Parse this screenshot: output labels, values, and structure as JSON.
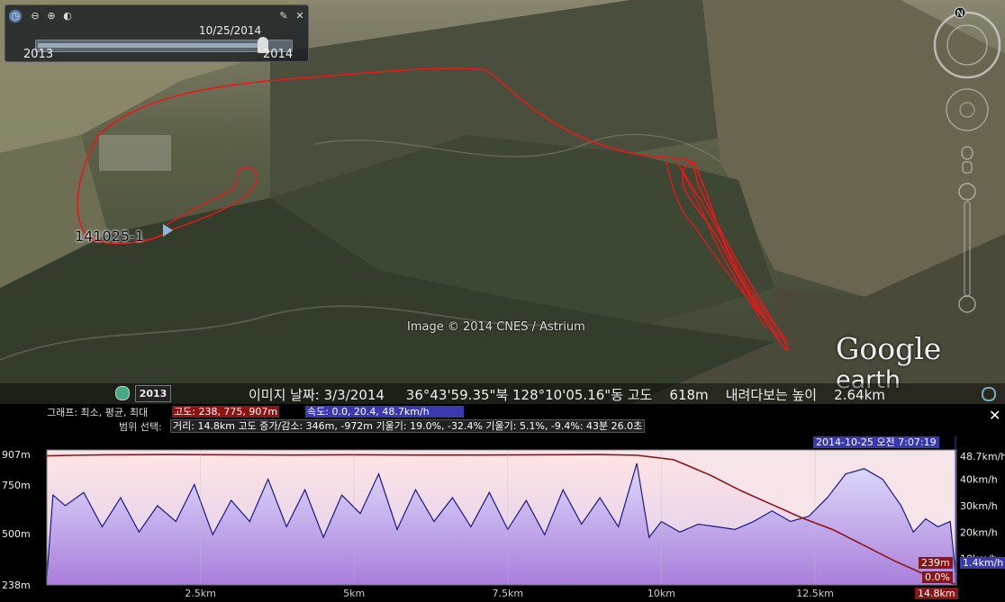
{
  "time_slider": {
    "current_date": "10/25/2014",
    "range_start": "2013",
    "range_end": "2014",
    "position_fraction": 0.9
  },
  "map": {
    "attribution": "Image © 2014 CNES / Astrium",
    "placemark_label": "141025-1",
    "logo_google": "Google",
    "logo_earth": "earth",
    "compass_letter": "N",
    "track_color": "#e8181a"
  },
  "status_bar": {
    "year_button": "2013",
    "text": "이미지 날짜: 3/3/2014     36°43'59.35\"북 128°10'05.16\"동 고도    618m    내려다보는 높이    2.64km"
  },
  "profile": {
    "graph_line_prefix": "그래프: 최소, 평균, 최대",
    "alt_stats": "고도: 238, 775, 907m",
    "speed_stats": "속도: 0.0, 20.4, 48.7km/h",
    "range_prefix": "범위 선택:",
    "range_stats": "거리: 14.8km 고도 증가/감소: 346m, -972m 기울기: 19.0%, -32.4% 기울기: 5.1%, -9.4%: 43분 26.0초",
    "hover_time": "2014-10-25 오전 7:07:19",
    "hover_alt": "239m",
    "hover_slope": "0.0%",
    "hover_dist": "14.8km",
    "hover_speed": "1.4km/h",
    "colors": {
      "altitude": "#8b1414",
      "speed": "#1a1a80",
      "alt_pill": "#8b1414",
      "speed_pill": "#3a3ab0"
    }
  },
  "chart_data": {
    "type": "area",
    "x_unit": "km",
    "xlim": [
      0,
      14.8
    ],
    "x_ticks": [
      "2.5km",
      "5km",
      "7.5km",
      "10km",
      "12.5km"
    ],
    "x_tick_values": [
      2.5,
      5,
      7.5,
      10,
      12.5
    ],
    "y_left_ticks": [
      "907m",
      "750m",
      "500m",
      "238m"
    ],
    "y_left_values": [
      907,
      750,
      500,
      238
    ],
    "ylim_left": [
      238,
      907
    ],
    "y_right_ticks": [
      "48.7km/h",
      "40km/h",
      "30km/h",
      "20km/h",
      "10km/h"
    ],
    "y_right_values": [
      48.7,
      40,
      30,
      20,
      10
    ],
    "ylim_right": [
      0,
      48.7
    ],
    "series": [
      {
        "name": "고도",
        "x": [
          0,
          0.5,
          1,
          2,
          3,
          4,
          5,
          6,
          7,
          8,
          9,
          9.6,
          10.2,
          10.8,
          11.3,
          11.8,
          12.3,
          12.8,
          13.3,
          13.8,
          14.3,
          14.8
        ],
        "values": [
          900,
          903,
          905,
          906,
          905,
          904,
          905,
          904,
          904,
          905,
          906,
          903,
          880,
          800,
          720,
          650,
          580,
          520,
          440,
          360,
          290,
          239
        ]
      },
      {
        "name": "속도",
        "x": [
          0,
          0.1,
          0.3,
          0.6,
          0.9,
          1.2,
          1.5,
          1.8,
          2.1,
          2.4,
          2.7,
          3.0,
          3.3,
          3.6,
          3.9,
          4.2,
          4.5,
          4.8,
          5.1,
          5.4,
          5.7,
          6.0,
          6.3,
          6.6,
          6.9,
          7.2,
          7.5,
          7.8,
          8.1,
          8.4,
          8.7,
          9.0,
          9.3,
          9.6,
          9.8,
          10.0,
          10.3,
          10.6,
          10.9,
          11.2,
          11.5,
          11.8,
          12.1,
          12.4,
          12.7,
          13.0,
          13.3,
          13.6,
          13.9,
          14.1,
          14.3,
          14.5,
          14.7,
          14.8
        ],
        "values": [
          3,
          34,
          30,
          35,
          22,
          33,
          20,
          30,
          24,
          38,
          19,
          32,
          24,
          40,
          22,
          36,
          18,
          34,
          27,
          42,
          21,
          36,
          24,
          33,
          22,
          35,
          21,
          32,
          19,
          36,
          23,
          33,
          22,
          46,
          18,
          24,
          20,
          23,
          22,
          21,
          24,
          28,
          24,
          26,
          33,
          42,
          44,
          40,
          30,
          20,
          25,
          22,
          24,
          1.4
        ]
      }
    ]
  }
}
